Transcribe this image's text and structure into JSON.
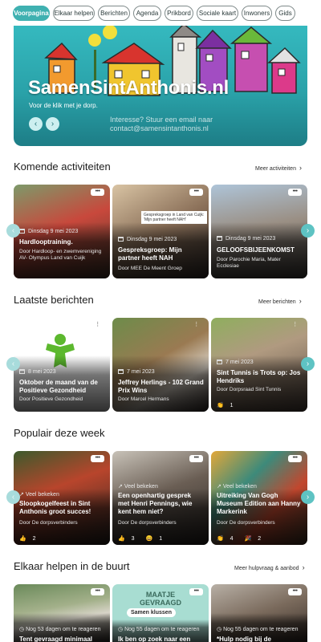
{
  "nav": {
    "items": [
      {
        "label": "Voorpagina",
        "active": true
      },
      {
        "label": "Elkaar helpen"
      },
      {
        "label": "Berichten"
      },
      {
        "label": "Agenda"
      },
      {
        "label": "Prikbord"
      },
      {
        "label": "Sociale kaart"
      },
      {
        "label": "Inwoners"
      },
      {
        "label": "Gids"
      }
    ]
  },
  "hero": {
    "title": "SamenSintAnthonis.nl",
    "subtitle": "Voor de klik met je dorp.",
    "contact_line1": "Interesse? Stuur een email naar",
    "contact_line2": "contact@samensintanthonis.nl",
    "prev_icon": "chevron-left-icon",
    "next_icon": "chevron-right-icon"
  },
  "activities": {
    "title": "Komende activiteiten",
    "more": "Meer activiteiten",
    "cards": [
      {
        "date": "Dinsdag 9 mei 2023",
        "title": "Hardlooptraining.",
        "by": "Door Hardloop- en zwemvereniging AV- Olympus Land van Cuijk"
      },
      {
        "date": "Dinsdag 9 mei 2023",
        "title": "Gespreksgroep: Mijn partner heeft NAH",
        "by": "Door MEE De Meent Groep",
        "image_text": "Gespreksgroep in Land van Cuijk: 'Mijn partner heeft NAH'"
      },
      {
        "date": "Dinsdag 9 mei 2023",
        "title": "GELOOFSBIJEENKOMST",
        "by": "Door Parochie Maria, Mater Ecclesiae"
      }
    ]
  },
  "posts": {
    "title": "Laatste berichten",
    "more": "Meer berichten",
    "cards": [
      {
        "date": "8 mei 2023",
        "title": "Oktober de maand van de Positieve Gezondheid",
        "by": "Door Positieve Gezondheid"
      },
      {
        "date": "7 mei 2023",
        "title": "Jeffrey Herlings - 102 Grand Prix Wins",
        "by": "Door Marcel Hermans"
      },
      {
        "date": "7 mei 2023",
        "title": "Sint Tunnis is Trots op: Jos Hendriks",
        "by": "Door Dorpsraad Sint Tunnis",
        "reactions": [
          {
            "icon": "clap-emoji",
            "glyph": "👏",
            "count": "1"
          }
        ]
      }
    ]
  },
  "popular": {
    "title": "Populair deze week",
    "cards": [
      {
        "badge": "Veel bekeken",
        "title": "Sloopkogelfeest in Sint Anthonis groot succes!",
        "by": "Door De dorpsverbinders",
        "reactions": [
          {
            "icon": "thumbs-up-emoji",
            "glyph": "👍",
            "count": "2"
          }
        ]
      },
      {
        "badge": "Veel bekeken",
        "title": "Een openhartig gesprek met Henri Pennings, wie kent hem niet?",
        "by": "Door De dorpsverbinders",
        "reactions": [
          {
            "icon": "thumbs-up-emoji",
            "glyph": "👍",
            "count": "3"
          },
          {
            "icon": "smile-emoji",
            "glyph": "😄",
            "count": "1"
          }
        ]
      },
      {
        "badge": "Veel bekeken",
        "title": "Uitreiking Van Gogh Museum Edition aan Hanny Markerink",
        "by": "Door De dorpsverbinders",
        "reactions": [
          {
            "icon": "clap-emoji",
            "glyph": "👏",
            "count": "4"
          },
          {
            "icon": "party-emoji",
            "glyph": "🎉",
            "count": "2"
          }
        ]
      }
    ]
  },
  "help": {
    "title": "Elkaar helpen in de buurt",
    "more": "Meer hulpvraag & aanbod",
    "cards": [
      {
        "meta": "Nog 53 dagen om te reageren",
        "title": "Tent gevraagd minimaal"
      },
      {
        "meta": "Nog 55 dagen om te reageren",
        "title": "Ik ben op zoek naar een",
        "image_line1": "MAATJE",
        "image_line2": "GEVRAAGD",
        "bubble": "Samen klussen"
      },
      {
        "meta": "Nog 55 dagen om te reageren",
        "title": "*Hulp nodig bij de"
      }
    ]
  },
  "colors": {
    "accent": "#3fb1b1",
    "hero_bg": "#35b9bf"
  }
}
